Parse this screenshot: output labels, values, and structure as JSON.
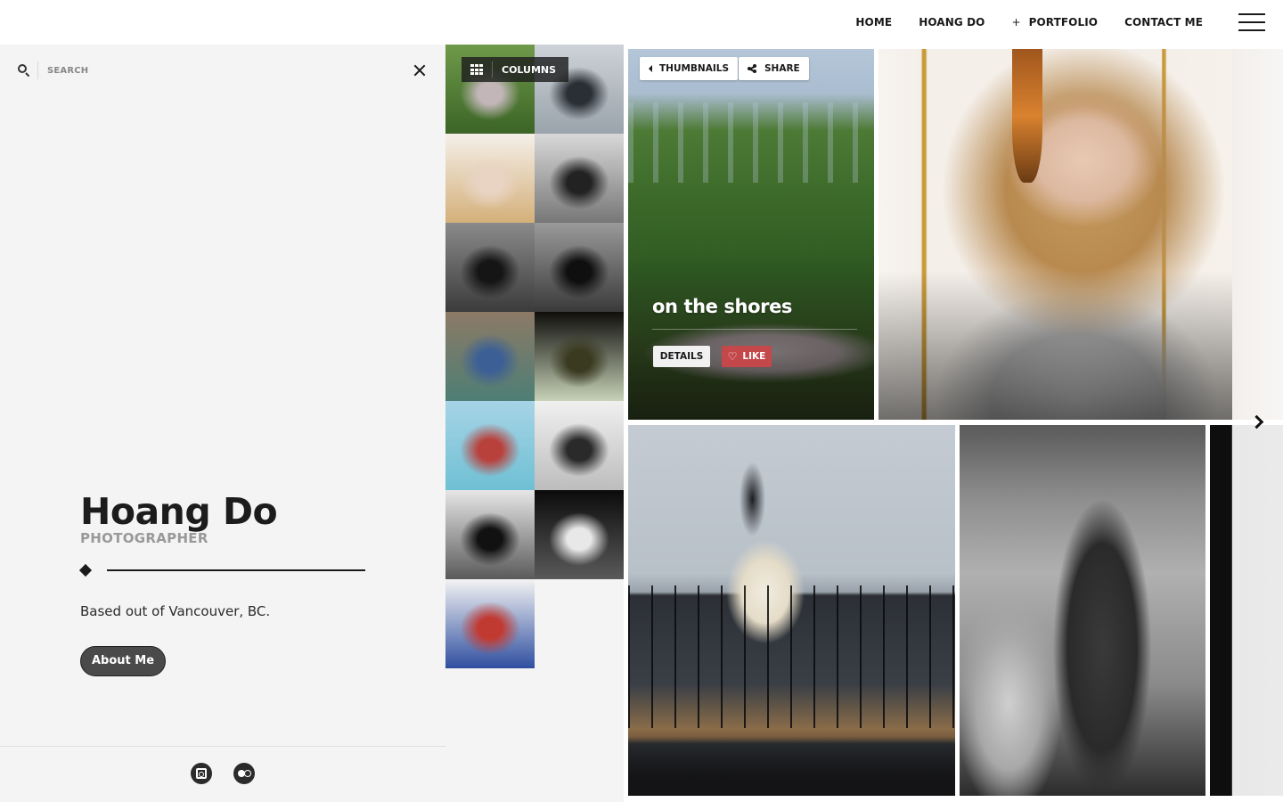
{
  "header": {
    "nav": [
      {
        "label": "HOME",
        "has_plus": false
      },
      {
        "label": "HOANG DO",
        "has_plus": false
      },
      {
        "label": "PORTFOLIO",
        "has_plus": true
      },
      {
        "label": "CONTACT ME",
        "has_plus": false
      }
    ],
    "plus_glyph": "+",
    "menu_icon": "hamburger-icon"
  },
  "sidebar": {
    "search": {
      "placeholder": "SEARCH",
      "value": "",
      "icon": "search-icon"
    },
    "close_icon": "close-icon",
    "name": "Hoang Do",
    "role": "PHOTOGRAPHER",
    "bio": "Based out of Vancouver, BC.",
    "about_button": "About Me",
    "social": [
      {
        "name": "instagram",
        "icon": "instagram-icon"
      },
      {
        "name": "flickr",
        "icon": "flickr-icon"
      }
    ]
  },
  "thumbnails": {
    "columns_label": "COLUMNS",
    "items": [
      {
        "subject": "couch in front of hedge",
        "colors": [
          "#6f9a4a",
          "#3b6426",
          "#c2b6b8"
        ]
      },
      {
        "subject": "woman sitting on railing",
        "colors": [
          "#cdd3d8",
          "#9aa3ab",
          "#2a2f36"
        ]
      },
      {
        "subject": "blonde woman portrait",
        "colors": [
          "#f4efe9",
          "#d4b07a",
          "#e9d3c3"
        ]
      },
      {
        "subject": "wedding ceremony bw",
        "colors": [
          "#d8d8d8",
          "#777777",
          "#222222"
        ]
      },
      {
        "subject": "dancing couple bw",
        "colors": [
          "#8a8a8a",
          "#3b3b3b",
          "#151515"
        ]
      },
      {
        "subject": "chapel interior bw",
        "colors": [
          "#9a9a9a",
          "#3a3a3a",
          "#0f0f0f"
        ]
      },
      {
        "subject": "grandparents with baby",
        "colors": [
          "#8c7a66",
          "#4e7e75",
          "#3c5f96"
        ]
      },
      {
        "subject": "white flower",
        "colors": [
          "#0f0e0b",
          "#c7d2b8",
          "#3a3a20"
        ]
      },
      {
        "subject": "PMP sign building",
        "colors": [
          "#a7d3e6",
          "#6fc0d4",
          "#b8413c"
        ]
      },
      {
        "subject": "silhouettes bw",
        "colors": [
          "#f0f0f0",
          "#bdbdbd",
          "#2a2a2a"
        ]
      },
      {
        "subject": "musicians bw",
        "colors": [
          "#e6e6e6",
          "#5a5a5a",
          "#111111"
        ]
      },
      {
        "subject": "woman tongue out bw",
        "colors": [
          "#0b0b0b",
          "#5a5a5a",
          "#e8e8e8"
        ]
      },
      {
        "subject": "jiu jitsu match",
        "colors": [
          "#f3f3f3",
          "#2f4fa0",
          "#c13a32"
        ]
      }
    ]
  },
  "gallery": {
    "toolbar": {
      "thumbnails_label": "THUMBNAILS",
      "share_label": "SHARE"
    },
    "featured": {
      "title": "on the shores",
      "details_label": "DETAILS",
      "like_label": "LIKE",
      "like_color": "#c4474a"
    },
    "next_icon": "chevron-right-icon"
  }
}
